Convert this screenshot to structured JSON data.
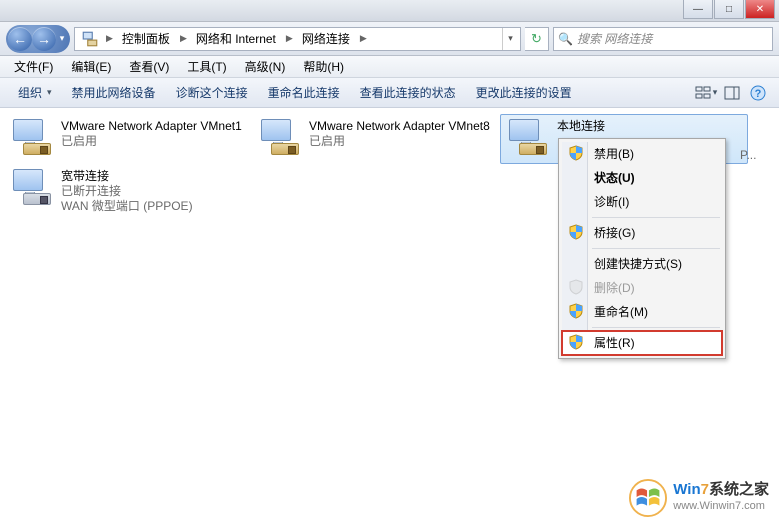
{
  "titlebar": {
    "text": ""
  },
  "window_buttons": {
    "min": "—",
    "max": "□",
    "close": "✕"
  },
  "nav": {
    "back": "←",
    "forward": "→",
    "dropdown": "▾",
    "refresh": "↻"
  },
  "breadcrumbs": {
    "seg0": "",
    "seg1": "控制面板",
    "seg2": "网络和 Internet",
    "seg3": "网络连接"
  },
  "search": {
    "icon": "🔍",
    "placeholder": "搜索 网络连接"
  },
  "menubar": {
    "file": "文件(F)",
    "edit": "编辑(E)",
    "view": "查看(V)",
    "tools": "工具(T)",
    "advanced": "高级(N)",
    "help": "帮助(H)"
  },
  "cmdbar": {
    "organize": "组织",
    "disable": "禁用此网络设备",
    "diagnose": "诊断这个连接",
    "rename": "重命名此连接",
    "status": "查看此连接的状态",
    "settings": "更改此连接的设置",
    "help": "?"
  },
  "adapters": {
    "a0": {
      "name": "VMware Network Adapter VMnet1",
      "status": "已启用",
      "detail": ""
    },
    "a1": {
      "name": "VMware Network Adapter VMnet8",
      "status": "已启用",
      "detail": ""
    },
    "a2": {
      "name": "本地连接",
      "status": "",
      "detail": ""
    },
    "a3": {
      "name": "宽带连接",
      "status": "已断开连接",
      "detail": "WAN 微型端口 (PPPOE)"
    }
  },
  "truncated_detail": "P...",
  "context_menu": {
    "disable": "禁用(B)",
    "status": "状态(U)",
    "diagnose": "诊断(I)",
    "bridge": "桥接(G)",
    "shortcut": "创建快捷方式(S)",
    "delete": "删除(D)",
    "rename": "重命名(M)",
    "properties": "属性(R)"
  },
  "watermark": {
    "line1a": "Win",
    "line1b": "7",
    "line1c": "系统之家",
    "line2": "www.Winwin7.com"
  }
}
